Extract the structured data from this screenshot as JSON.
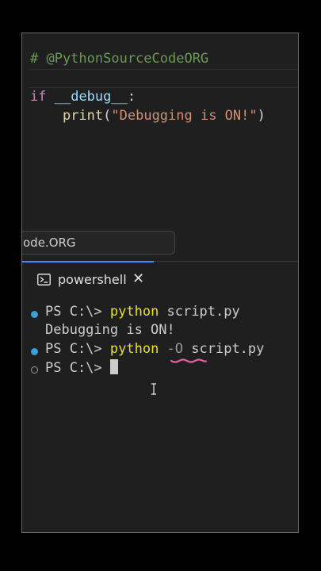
{
  "editor": {
    "comment": "# @PythonSourceCodeORG",
    "line_if": {
      "keyword": "if",
      "space": " ",
      "variable": "__debug__",
      "colon": ":"
    },
    "line_print": {
      "indent": "    ",
      "fn": "print",
      "open": "(",
      "string": "\"Debugging is ON!\"",
      "close": ")"
    }
  },
  "popup": {
    "text": "ode.ORG"
  },
  "panel": {
    "tab_label": "powershell",
    "tab_close": "✕",
    "tab_icon": "terminal-icon"
  },
  "terminal": {
    "line1": {
      "prompt": "PS C:\\> ",
      "cmd": "python",
      "args": " script.py"
    },
    "line2": {
      "text": "Debugging is ON!"
    },
    "line3": {
      "prompt": "PS C:\\> ",
      "cmd": "python",
      "flag": " -O",
      "args": " script.py"
    },
    "line4": {
      "prompt": "PS C:\\> "
    }
  },
  "colors": {
    "keyword": "#c586c0",
    "variable": "#9cdcfe",
    "function": "#dcdcaa",
    "string": "#ce9178",
    "comment": "#6a9955",
    "command": "#e5e510",
    "status_dot": "#3e9ed6",
    "squiggle": "#e05fa0",
    "tab_accent": "#3794ff"
  }
}
